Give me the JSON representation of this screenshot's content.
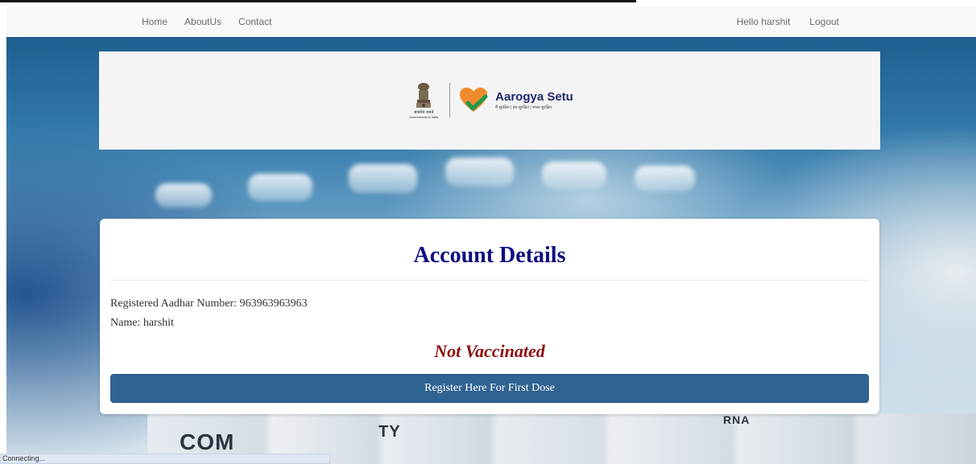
{
  "nav": {
    "links": [
      "Home",
      "AboutUs",
      "Contact"
    ],
    "greeting": "Hello harshit",
    "logout": "Logout"
  },
  "banner": {
    "emblem_line1": "सत्यमेव जयते",
    "emblem_line2": "Government of India",
    "app_name": "Aarogya Setu",
    "tagline": "मैं सुरक्षित | हम सुरक्षित | भारत सुरक्षित"
  },
  "card": {
    "title": "Account Details",
    "aadhar_line": "Registered Aadhar Number: 963963963963",
    "name_line": "Name: harshit",
    "status": "Not Vaccinated",
    "register_label": "Register Here For First Dose"
  },
  "background_text": [
    "COM",
    "TY",
    "RNA"
  ],
  "statusbar": {
    "text": "Connecting..."
  },
  "colors": {
    "title": "#0e0e7e",
    "status": "#8b0e0e",
    "button": "#2f6391",
    "heart": "#f08a2c",
    "check": "#1c9a4a"
  },
  "icons": {
    "emblem": "national-emblem-icon",
    "logo": "heart-check-icon"
  }
}
